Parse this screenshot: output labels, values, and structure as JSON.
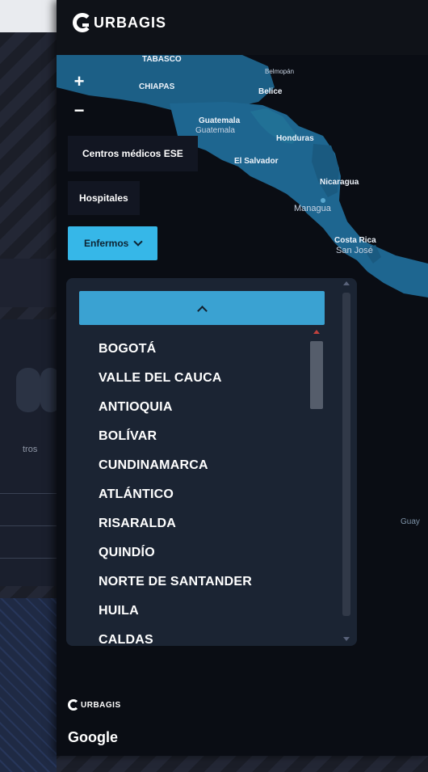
{
  "header": {
    "logo_text": "URBAGIS"
  },
  "map": {
    "labels": {
      "tabasco": "TABASCO",
      "chiapas": "CHIAPAS",
      "belmopan": "Belmopán",
      "belice": "Belice",
      "guatemala_country": "Guatemala",
      "guatemala_city": "Guatemala",
      "honduras": "Honduras",
      "el_salvador": "El Salvador",
      "nicaragua": "Nicaragua",
      "managua": "Managua",
      "costa_rica": "Costa Rica",
      "san_jose": "San José",
      "guyana": "Guay"
    },
    "zoom_in": "+",
    "zoom_out": "−"
  },
  "layers": {
    "centros_medicos": "Centros médicos ESE",
    "hospitales": "Hospitales",
    "enfermos": "Enfermos"
  },
  "dropdown": {
    "items": [
      "BOGOTÁ",
      "VALLE DEL CAUCA",
      "ANTIOQUIA",
      "BOLÍVAR",
      "CUNDINAMARCA",
      "ATLÁNTICO",
      "RISARALDA",
      "QUINDÍO",
      "NORTE DE SANTANDER",
      "HUILA",
      "CALDAS"
    ]
  },
  "footer": {
    "brand": "URBAGIS",
    "attribution": "Google"
  },
  "background": {
    "partial_text": "tros"
  },
  "colors": {
    "accent": "#36b7e8",
    "map_water": "#0a0d14",
    "map_land": "#1c5f86"
  }
}
